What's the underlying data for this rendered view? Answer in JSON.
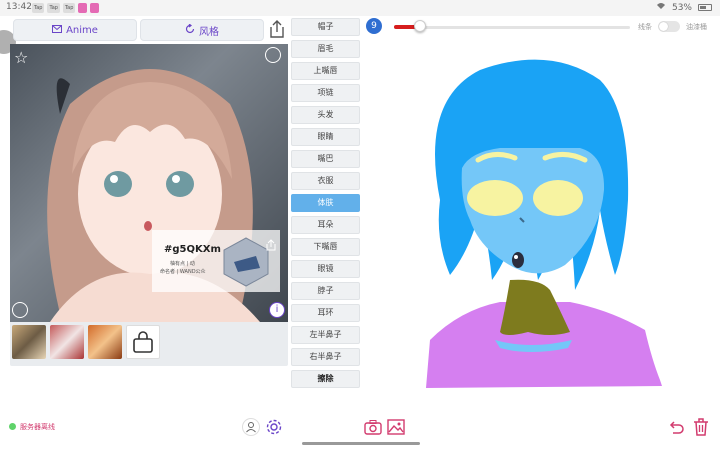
{
  "status_bar": {
    "time": "13:42",
    "notifications": [
      "Tap",
      "Tap",
      "Tap"
    ],
    "battery": "53%"
  },
  "header": {
    "anime_label": "Anime",
    "style_label": "风格"
  },
  "portrait": {
    "code": "#g5QKXm",
    "line1": "柚有点 | 动",
    "line2": "命名者 | WAND公众"
  },
  "parts": [
    {
      "label": "帽子",
      "active": false
    },
    {
      "label": "眉毛",
      "active": false
    },
    {
      "label": "上嘴唇",
      "active": false
    },
    {
      "label": "项链",
      "active": false
    },
    {
      "label": "头发",
      "active": false
    },
    {
      "label": "眼睛",
      "active": false
    },
    {
      "label": "嘴巴",
      "active": false
    },
    {
      "label": "衣服",
      "active": false
    },
    {
      "label": "体肤",
      "active": true
    },
    {
      "label": "耳朵",
      "active": false
    },
    {
      "label": "下嘴唇",
      "active": false
    },
    {
      "label": "眼镜",
      "active": false
    },
    {
      "label": "脖子",
      "active": false
    },
    {
      "label": "耳环",
      "active": false
    },
    {
      "label": "左半鼻子",
      "active": false
    },
    {
      "label": "右半鼻子",
      "active": false
    }
  ],
  "erase_label": "擦除",
  "brush": {
    "size": "9",
    "size_fraction": 0.11,
    "color": "#d61d1d",
    "mode_left": "线条",
    "mode_right": "油漆桶",
    "fill_mode": false
  },
  "footer": {
    "server_status": "服务器离线"
  },
  "colors": {
    "accent": "#6a45c8",
    "active_part": "#62b0ea",
    "hair": "#1aa3f5",
    "skin": "#74c7f8",
    "eyes": "#f7f3a1",
    "neck": "#7e7b1e",
    "clothes": "#d57ff0"
  }
}
